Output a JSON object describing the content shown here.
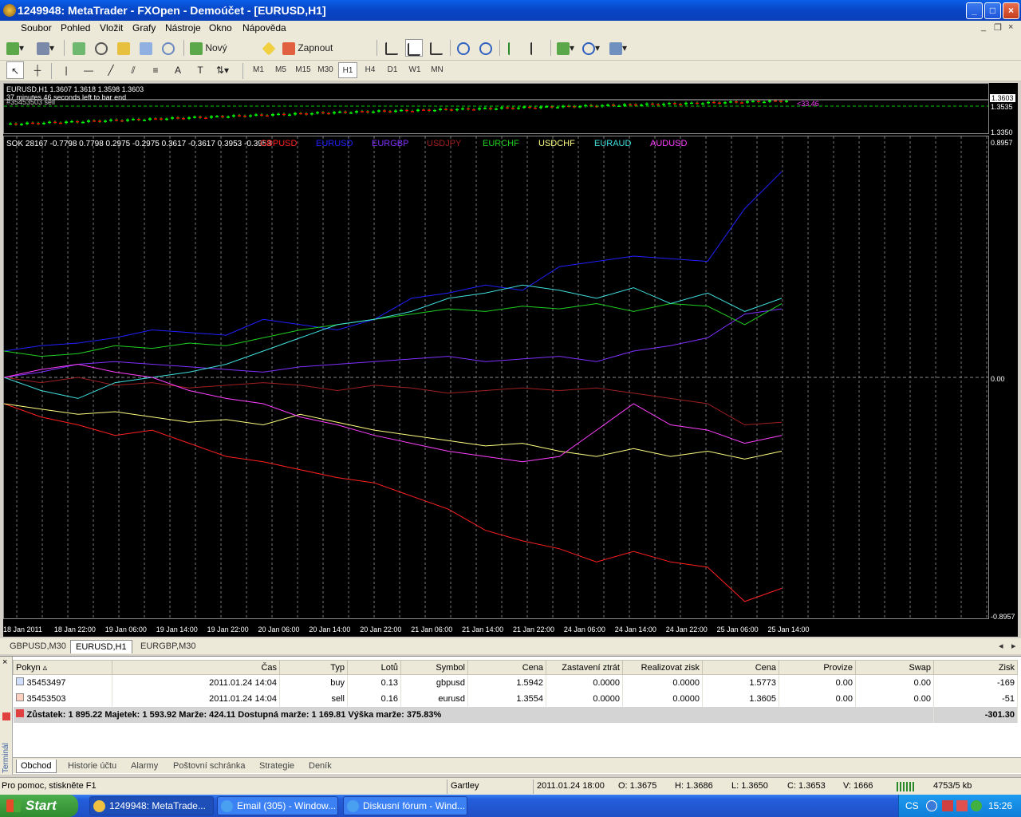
{
  "window": {
    "title": "1249948: MetaTrader - FXOpen - Demoúčet - [EURUSD,H1]"
  },
  "menu": [
    "Soubor",
    "Pohled",
    "Vložit",
    "Grafy",
    "Nástroje",
    "Okno",
    "Nápověda"
  ],
  "toolbar": {
    "new_order": "Nový pokyn",
    "expert": "Zapnout strategie"
  },
  "timeframes": [
    "M1",
    "M5",
    "M15",
    "M30",
    "H1",
    "H4",
    "D1",
    "W1",
    "MN"
  ],
  "timeframe_active": "H1",
  "main_chart": {
    "info": "EURUSD,H1  1.3607 1.3618 1.3598 1.3603",
    "countdown": "37 minutes 46 seconds left to bar end",
    "order_label": "#35453503 sell",
    "profit_label": "<33.46",
    "price_high": "1.3603",
    "price_mid": "1.3535",
    "price_low": "1.3350"
  },
  "indicator": {
    "header": "SOK 28167 -0.7798 0.7798 0.2975 -0.2975 0.3617 -0.3617 0.3953 -0.3953",
    "axis_top": "0.8957",
    "axis_zero": "0.00",
    "axis_bottom": "-0.8957"
  },
  "x_labels": [
    "18 Jan 2011",
    "18 Jan 22:00",
    "19 Jan 06:00",
    "19 Jan 14:00",
    "19 Jan 22:00",
    "20 Jan 06:00",
    "20 Jan 14:00",
    "20 Jan 22:00",
    "21 Jan 06:00",
    "21 Jan 14:00",
    "21 Jan 22:00",
    "24 Jan 06:00",
    "24 Jan 14:00",
    "24 Jan 22:00",
    "25 Jan 06:00",
    "25 Jan 14:00"
  ],
  "chart_data": {
    "type": "line",
    "series": [
      {
        "name": "GBPUSD",
        "color": "#ff2020",
        "values": [
          -0.1,
          -0.15,
          -0.18,
          -0.22,
          -0.2,
          -0.25,
          -0.3,
          -0.32,
          -0.35,
          -0.38,
          -0.4,
          -0.45,
          -0.5,
          -0.58,
          -0.62,
          -0.65,
          -0.7,
          -0.66,
          -0.7,
          -0.72,
          -0.85,
          -0.8
        ]
      },
      {
        "name": "EURUSD",
        "color": "#2020ff",
        "values": [
          0.1,
          0.12,
          0.13,
          0.15,
          0.18,
          0.17,
          0.16,
          0.22,
          0.2,
          0.18,
          0.22,
          0.3,
          0.32,
          0.35,
          0.33,
          0.42,
          0.44,
          0.46,
          0.45,
          0.44,
          0.64,
          0.78
        ]
      },
      {
        "name": "EURGBP",
        "color": "#8030ff",
        "values": [
          0.0,
          0.02,
          0.05,
          0.06,
          0.05,
          0.04,
          0.03,
          0.02,
          0.04,
          0.05,
          0.06,
          0.07,
          0.08,
          0.06,
          0.07,
          0.08,
          0.06,
          0.1,
          0.12,
          0.15,
          0.24,
          0.26
        ]
      },
      {
        "name": "USDJPY",
        "color": "#a02020",
        "values": [
          0.0,
          -0.02,
          0.0,
          -0.03,
          -0.02,
          -0.04,
          -0.03,
          -0.02,
          -0.03,
          -0.05,
          -0.03,
          -0.04,
          -0.06,
          -0.05,
          -0.04,
          -0.05,
          -0.04,
          -0.06,
          -0.08,
          -0.1,
          -0.18,
          -0.17
        ]
      },
      {
        "name": "EURCHF",
        "color": "#20d020",
        "values": [
          0.1,
          0.08,
          0.09,
          0.12,
          0.11,
          0.13,
          0.12,
          0.15,
          0.18,
          0.2,
          0.22,
          0.24,
          0.26,
          0.25,
          0.27,
          0.26,
          0.28,
          0.25,
          0.28,
          0.27,
          0.2,
          0.28
        ]
      },
      {
        "name": "USDCHF",
        "color": "#ffff80",
        "values": [
          -0.1,
          -0.12,
          -0.14,
          -0.13,
          -0.15,
          -0.17,
          -0.16,
          -0.18,
          -0.14,
          -0.17,
          -0.2,
          -0.22,
          -0.24,
          -0.26,
          -0.25,
          -0.28,
          -0.3,
          -0.27,
          -0.3,
          -0.28,
          -0.31,
          -0.28
        ]
      },
      {
        "name": "EURAUD",
        "color": "#40e0e0",
        "values": [
          0.0,
          -0.05,
          -0.08,
          -0.02,
          0.0,
          0.02,
          0.05,
          0.1,
          0.15,
          0.2,
          0.22,
          0.25,
          0.3,
          0.32,
          0.35,
          0.33,
          0.3,
          0.34,
          0.28,
          0.32,
          0.25,
          0.3
        ]
      },
      {
        "name": "AUDUSD",
        "color": "#ff40ff",
        "values": [
          0.0,
          0.03,
          0.05,
          0.02,
          0.0,
          -0.05,
          -0.08,
          -0.1,
          -0.15,
          -0.18,
          -0.22,
          -0.25,
          -0.28,
          -0.3,
          -0.32,
          -0.3,
          -0.2,
          -0.1,
          -0.18,
          -0.2,
          -0.25,
          -0.22
        ]
      }
    ],
    "ylim": [
      -0.8957,
      0.8957
    ]
  },
  "chart_tabs": [
    "GBPUSD,M30",
    "EURUSD,H1",
    "EURGBP,M30"
  ],
  "chart_tab_active": 1,
  "orders": {
    "headers": [
      "Pokyn",
      "Čas",
      "Typ",
      "Lotů",
      "Symbol",
      "Cena",
      "Zastavení ztrát",
      "Realizovat zisk",
      "Cena",
      "Provize",
      "Swap",
      "Zisk"
    ],
    "rows": [
      [
        "35453497",
        "2011.01.24 14:04",
        "buy",
        "0.13",
        "gbpusd",
        "1.5942",
        "0.0000",
        "0.0000",
        "1.5773",
        "0.00",
        "0.00",
        "-169"
      ],
      [
        "35453503",
        "2011.01.24 14:04",
        "sell",
        "0.16",
        "eurusd",
        "1.3554",
        "0.0000",
        "0.0000",
        "1.3605",
        "0.00",
        "0.00",
        "-51"
      ]
    ],
    "balance": "Zůstatek: 1 895.22  Majetek: 1 593.92  Marže: 424.11  Dostupná marže: 1 169.81  Výška marže: 375.83%",
    "total": "-301.30"
  },
  "terminal_label": "Terminál",
  "terminal_tabs": [
    "Obchod",
    "Historie účtu",
    "Alarmy",
    "Poštovní schránka",
    "Strategie",
    "Deník"
  ],
  "status": {
    "help": "Pro pomoc, stiskněte F1",
    "profile": "Gartley",
    "time": "2011.01.24 18:00",
    "open": "O: 1.3675",
    "high": "H: 1.3686",
    "low": "L: 1.3650",
    "close": "C: 1.3653",
    "volume": "V: 1666",
    "traffic": "4753/5 kb"
  },
  "taskbar": {
    "start": "Start",
    "tasks": [
      "1249948: MetaTrade...",
      "Email (305) - Window...",
      "Diskusní fórum - Wind..."
    ],
    "lang": "CS",
    "clock": "15:26"
  }
}
